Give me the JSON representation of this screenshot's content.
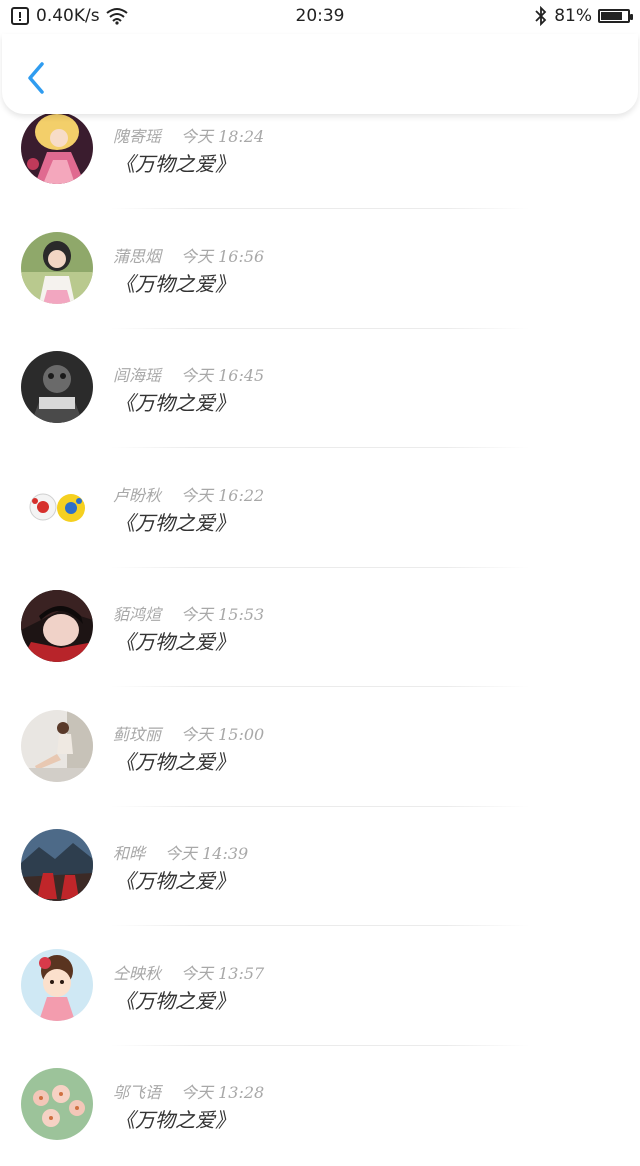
{
  "status_bar": {
    "speed": "0.40K/s",
    "time": "20:39",
    "battery": "81%",
    "battery_level": 0.81
  },
  "header": {
    "back_icon": "chevron-left-icon",
    "accent": "#2f9cf0"
  },
  "items": [
    {
      "name": "隗寄瑶",
      "time": "今天 18:24",
      "title": "《万物之爱》"
    },
    {
      "name": "蒲思烟",
      "time": "今天 16:56",
      "title": "《万物之爱》"
    },
    {
      "name": "闾海瑶",
      "time": "今天 16:45",
      "title": "《万物之爱》"
    },
    {
      "name": "卢盼秋",
      "time": "今天 16:22",
      "title": "《万物之爱》"
    },
    {
      "name": "貊鸿煊",
      "time": "今天 15:53",
      "title": "《万物之爱》"
    },
    {
      "name": "蓟玟丽",
      "time": "今天 15:00",
      "title": "《万物之爱》"
    },
    {
      "name": "和晔",
      "time": "今天 14:39",
      "title": "《万物之爱》"
    },
    {
      "name": "仝映秋",
      "time": "今天 13:57",
      "title": "《万物之爱》"
    },
    {
      "name": "邬飞语",
      "time": "今天 13:28",
      "title": "《万物之爱》"
    }
  ]
}
